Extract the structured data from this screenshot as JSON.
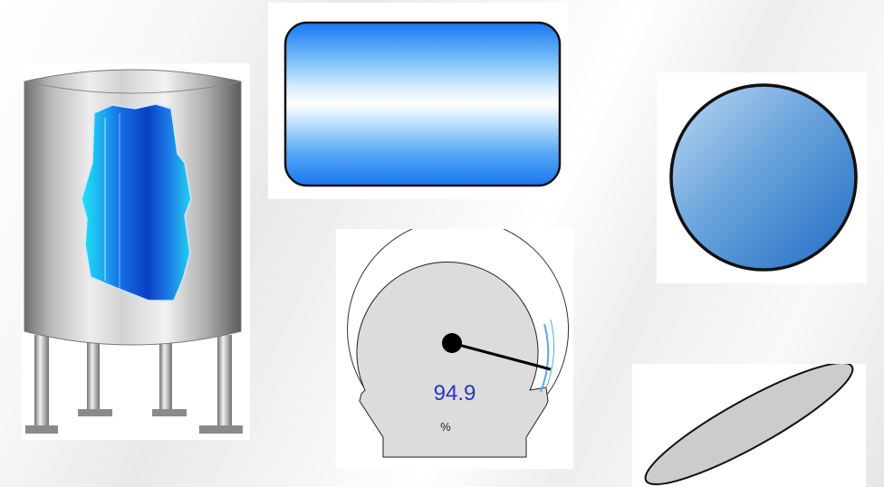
{
  "gauge": {
    "value": "94.9",
    "unit": "%",
    "level_fraction": 0.949
  },
  "colors": {
    "tank_liquid": "#0a3dbf",
    "tank_liquid_edge": "#18e0f0",
    "rectangle_fill": "#4aa2f0",
    "circle_fill": "#4a8fd0",
    "ellipse_fill": "#cccccc",
    "gauge_face": "#dcdcdc",
    "gauge_value_text": "#2a34c8"
  },
  "shapes": {
    "tank": "vessel-tank",
    "rectangle": "rounded-rectangle",
    "circle": "circle",
    "gauge": "radial-gauge",
    "ellipse": "rotated-ellipse"
  }
}
